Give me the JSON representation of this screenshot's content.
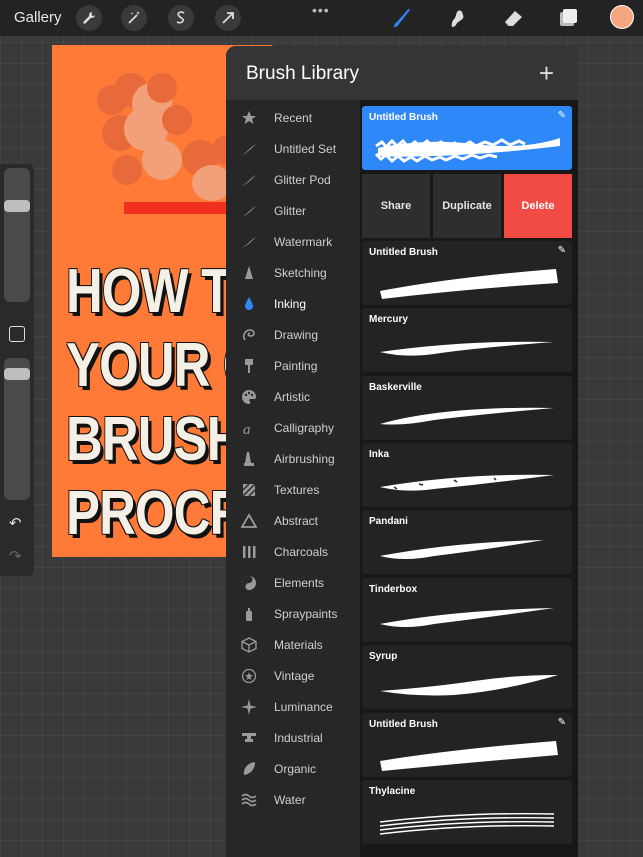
{
  "topbar": {
    "gallery_label": "Gallery",
    "more_label": "•••"
  },
  "canvas": {
    "text_lines": "HOW T\nYOUR C\nBRUSH\nPROCR"
  },
  "panel": {
    "title": "Brush Library",
    "add_label": "+"
  },
  "categories": [
    {
      "label": "Recent",
      "icon": "star-icon"
    },
    {
      "label": "Untitled Set",
      "icon": "stroke-icon"
    },
    {
      "label": "Glitter Pod",
      "icon": "stroke-icon"
    },
    {
      "label": "Glitter",
      "icon": "stroke-icon"
    },
    {
      "label": "Watermark",
      "icon": "stroke-icon"
    },
    {
      "label": "Sketching",
      "icon": "pencil-icon"
    },
    {
      "label": "Inking",
      "icon": "ink-drop-icon"
    },
    {
      "label": "Drawing",
      "icon": "spiral-icon"
    },
    {
      "label": "Painting",
      "icon": "paint-brush-icon"
    },
    {
      "label": "Artistic",
      "icon": "palette-icon"
    },
    {
      "label": "Calligraphy",
      "icon": "calligraphy-icon"
    },
    {
      "label": "Airbrushing",
      "icon": "airbrush-icon"
    },
    {
      "label": "Textures",
      "icon": "texture-icon"
    },
    {
      "label": "Abstract",
      "icon": "triangle-icon"
    },
    {
      "label": "Charcoals",
      "icon": "charcoal-icon"
    },
    {
      "label": "Elements",
      "icon": "yin-yang-icon"
    },
    {
      "label": "Spraypaints",
      "icon": "spray-can-icon"
    },
    {
      "label": "Materials",
      "icon": "cube-icon"
    },
    {
      "label": "Vintage",
      "icon": "vintage-star-icon"
    },
    {
      "label": "Luminance",
      "icon": "sparkle-icon"
    },
    {
      "label": "Industrial",
      "icon": "anvil-icon"
    },
    {
      "label": "Organic",
      "icon": "leaf-icon"
    },
    {
      "label": "Water",
      "icon": "waves-icon"
    }
  ],
  "brushes": [
    {
      "name": "Untitled Brush",
      "selected": true,
      "custom": true
    },
    {
      "name": "Untitled Brush",
      "custom": true
    },
    {
      "name": "Mercury"
    },
    {
      "name": "Baskerville"
    },
    {
      "name": "Inka"
    },
    {
      "name": "Pandani"
    },
    {
      "name": "Tinderbox"
    },
    {
      "name": "Syrup"
    },
    {
      "name": "Untitled Brush",
      "custom": true
    },
    {
      "name": "Thylacine"
    }
  ],
  "actions": {
    "share": "Share",
    "duplicate": "Duplicate",
    "delete": "Delete"
  },
  "colors": {
    "accent": "#2f88f7",
    "delete": "#f24a45",
    "canvas": "#ff7a36",
    "current_color": "#f5a782",
    "arrow": "#f2301f",
    "selected_brush_icon": "#2f88f7"
  }
}
